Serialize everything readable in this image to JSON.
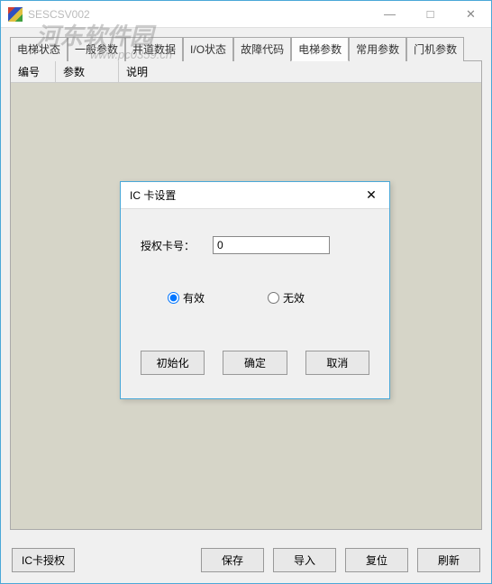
{
  "window": {
    "title": "SESCSV002",
    "minimize": "—",
    "maximize": "□",
    "close": "✕"
  },
  "watermark": {
    "main": "河东软件园",
    "sub": "www.pc0359.cn"
  },
  "tabs": [
    {
      "label": "电梯状态"
    },
    {
      "label": "一般参数"
    },
    {
      "label": "井道数据"
    },
    {
      "label": "I/O状态"
    },
    {
      "label": "故障代码"
    },
    {
      "label": "电梯参数"
    },
    {
      "label": "常用参数"
    },
    {
      "label": "门机参数"
    }
  ],
  "activeTab": 5,
  "table": {
    "col_no": "编号",
    "col_param": "参数",
    "col_desc": "说明"
  },
  "buttons": {
    "ic_auth": "IC卡授权",
    "save": "保存",
    "import": "导入",
    "reset": "复位",
    "refresh": "刷新"
  },
  "dialog": {
    "title": "IC 卡设置",
    "close": "✕",
    "label_card": "授权卡号：",
    "card_value": "0",
    "radio_valid": "有效",
    "radio_invalid": "无效",
    "btn_init": "初始化",
    "btn_ok": "确定",
    "btn_cancel": "取消"
  }
}
